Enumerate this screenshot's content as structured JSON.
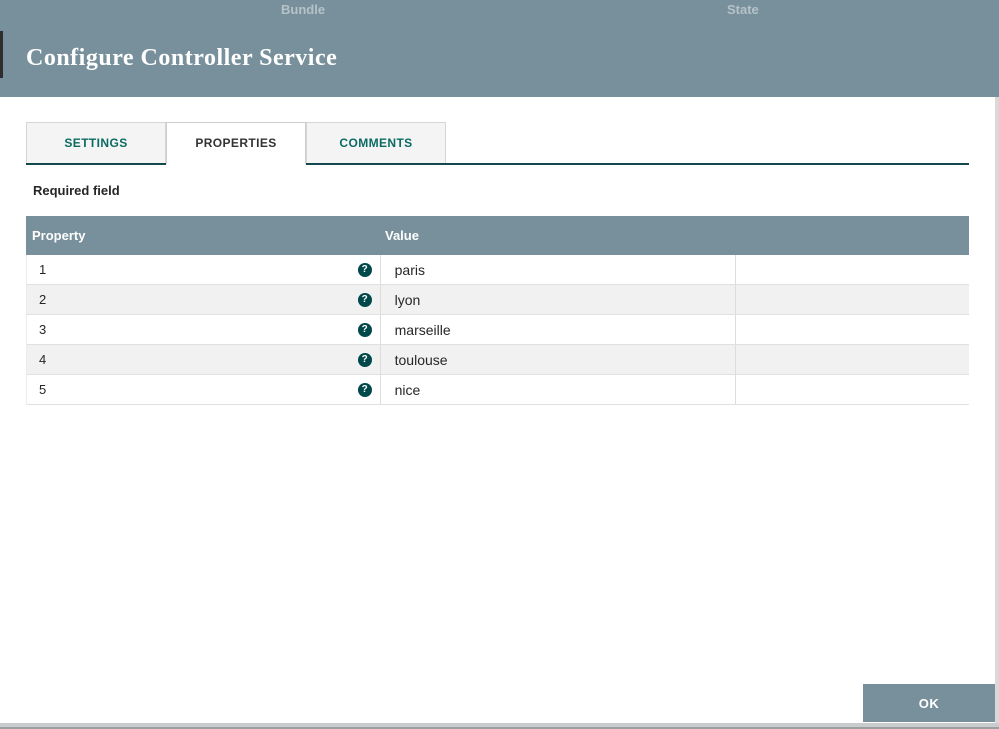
{
  "dialog": {
    "title": "Configure Controller Service",
    "header_labels": {
      "bundle": "Bundle",
      "state": "State"
    }
  },
  "tabs": [
    {
      "label": "SETTINGS"
    },
    {
      "label": "PROPERTIES"
    },
    {
      "label": "COMMENTS"
    }
  ],
  "active_tab": "PROPERTIES",
  "content": {
    "required_field_label": "Required field"
  },
  "table": {
    "columns": [
      "Property",
      "Value"
    ],
    "rows": [
      {
        "property": "1",
        "value": "paris"
      },
      {
        "property": "2",
        "value": "lyon"
      },
      {
        "property": "3",
        "value": "marseille"
      },
      {
        "property": "4",
        "value": "toulouse"
      },
      {
        "property": "5",
        "value": "nice"
      }
    ]
  },
  "icons": {
    "help": "?"
  },
  "footer": {
    "ok_label": "OK"
  },
  "colors": {
    "header_bg": "#78909B",
    "accent_teal": "#0B6B62",
    "tab_underline": "#14484F",
    "table_header_bg": "#78909B",
    "help_icon_bg": "#004849",
    "ok_button_bg": "#78909B",
    "backdrop": "#D9D9D9"
  }
}
